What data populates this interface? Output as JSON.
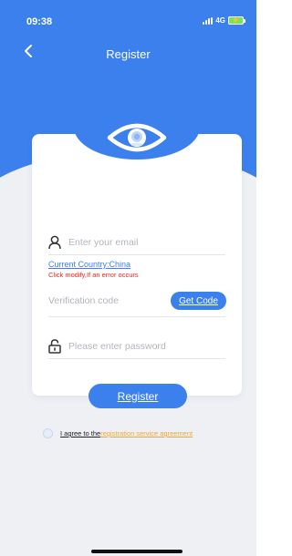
{
  "status_bar": {
    "time": "09:38",
    "network": "4G",
    "battery_glyph": "⚡",
    "battery_color": "#7be25a"
  },
  "nav": {
    "title": "Register",
    "back_icon": "chevron-left-icon"
  },
  "colors": {
    "accent": "#3c80ee",
    "error": "#e5281f",
    "link_orange": "#f3a43a",
    "background": "#eef0f4"
  },
  "form": {
    "email": {
      "placeholder": "Enter your email",
      "value": "",
      "icon": "user-icon"
    },
    "country": {
      "label": "Current Country:China"
    },
    "error_hint": "Click modify,If an error occurs",
    "verification": {
      "placeholder": "Verification code",
      "value": ""
    },
    "get_code_label": "Get Code",
    "password": {
      "placeholder": "Please enter password",
      "value": "",
      "icon": "lock-icon"
    },
    "register_label": "Register"
  },
  "agreement": {
    "prefix": "I agree to the",
    "link_text": "registration service agreement",
    "checked": false
  }
}
